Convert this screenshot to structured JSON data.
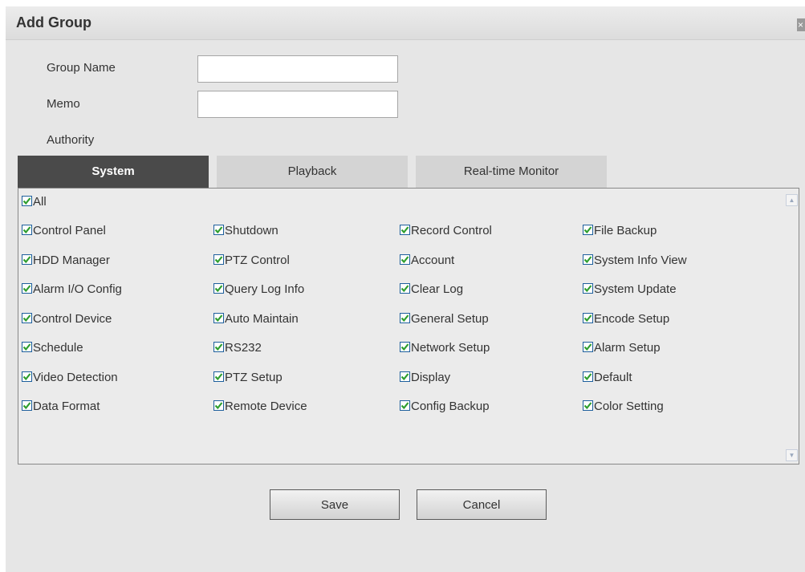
{
  "dialog": {
    "title": "Add Group",
    "close_icon": "close-icon"
  },
  "form": {
    "group_name_label": "Group Name",
    "group_name_value": "",
    "memo_label": "Memo",
    "memo_value": "",
    "authority_label": "Authority"
  },
  "tabs": [
    {
      "label": "System",
      "active": true
    },
    {
      "label": "Playback",
      "active": false
    },
    {
      "label": "Real-time Monitor",
      "active": false
    }
  ],
  "permissions": {
    "all_label": "All",
    "all_checked": true,
    "rows": [
      [
        "Control Panel",
        "Shutdown",
        "Record Control",
        "File Backup"
      ],
      [
        "HDD Manager",
        "PTZ Control",
        "Account",
        "System Info View"
      ],
      [
        "Alarm I/O Config",
        "Query Log Info",
        "Clear Log",
        "System Update"
      ],
      [
        "Control Device",
        "Auto Maintain",
        "General Setup",
        "Encode Setup"
      ],
      [
        "Schedule",
        "RS232",
        "Network Setup",
        "Alarm Setup"
      ],
      [
        "Video Detection",
        "PTZ Setup",
        "Display",
        "Default"
      ],
      [
        "Data Format",
        "Remote Device",
        "Config Backup",
        "Color Setting"
      ]
    ],
    "all_items_checked": true
  },
  "buttons": {
    "save_label": "Save",
    "cancel_label": "Cancel"
  },
  "colors": {
    "active_tab": "#4a4a4a",
    "inactive_tab": "#d4d4d4",
    "checkmark": "#2e9e2e",
    "checkbox_border": "#1d5f9c"
  }
}
